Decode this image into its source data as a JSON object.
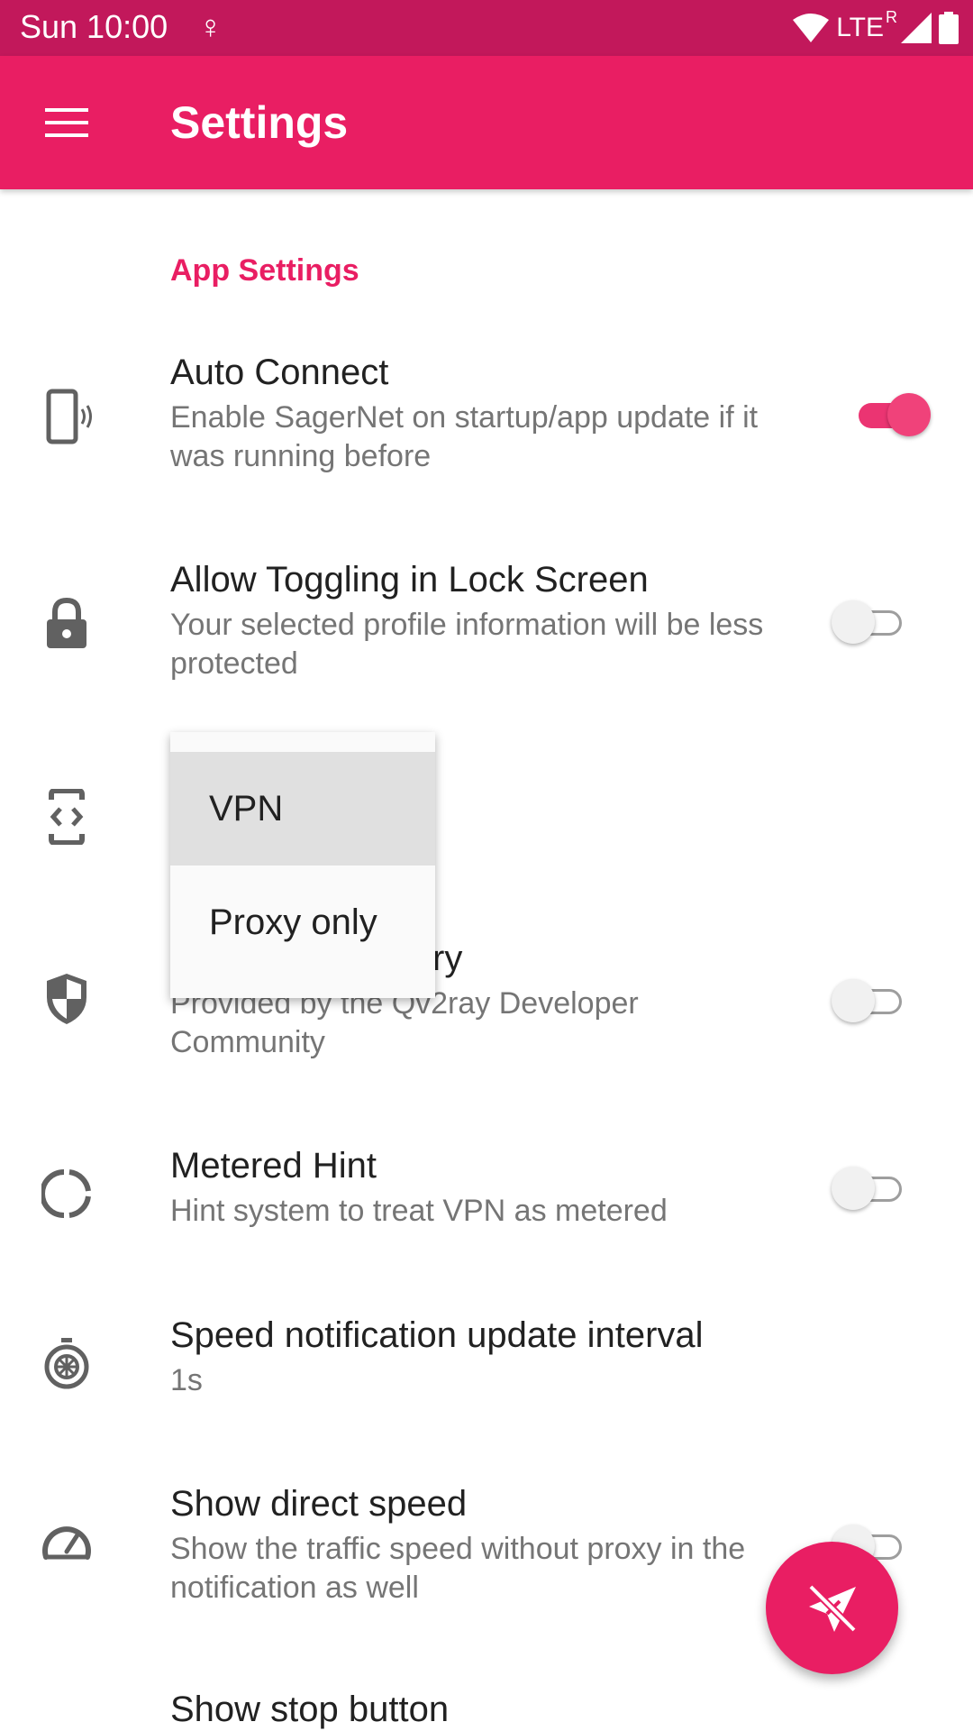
{
  "status_bar": {
    "time": "Sun 10:00",
    "network": "LTE",
    "roaming": "R",
    "icons": [
      "female-sign-icon",
      "wifi-icon",
      "signal-icon",
      "battery-icon"
    ],
    "color": "#c2185b"
  },
  "app_bar": {
    "title": "Settings",
    "color": "#e91e63",
    "menu_icon": "hamburger-menu-icon"
  },
  "section": {
    "title": "App Settings",
    "accent": "#e91e63"
  },
  "preferences": [
    {
      "title": "Auto Connect",
      "summary": "Enable SagerNet on startup/app update if it was running before",
      "icon": "phone-vibrate-icon",
      "switch_on": true
    },
    {
      "title": "Allow Toggling in Lock Screen",
      "summary": "Your selected profile information will be less protected",
      "icon": "lock-icon",
      "switch_on": false
    },
    {
      "title": "",
      "summary": "",
      "icon": "code-frame-icon"
    },
    {
      "title_visible": "ry",
      "summary": "Provided by the Qv2ray Developer Community",
      "icon": "shield-icon",
      "switch_on": false
    },
    {
      "title": "Metered Hint",
      "summary": "Hint system to treat VPN as metered",
      "icon": "data-usage-icon",
      "switch_on": false
    },
    {
      "title": "Speed notification update interval",
      "summary": "1s",
      "icon": "timer-icon"
    },
    {
      "title": "Show direct speed",
      "summary": "Show the traffic speed without proxy in the notification as well",
      "icon": "speedometer-icon",
      "switch_on": false
    },
    {
      "title": "Show stop button",
      "switch_on": false
    }
  ],
  "popup_menu": {
    "items": [
      "VPN",
      "Proxy only"
    ],
    "selected": "VPN"
  },
  "fab": {
    "icon": "paper-plane-off-icon"
  }
}
